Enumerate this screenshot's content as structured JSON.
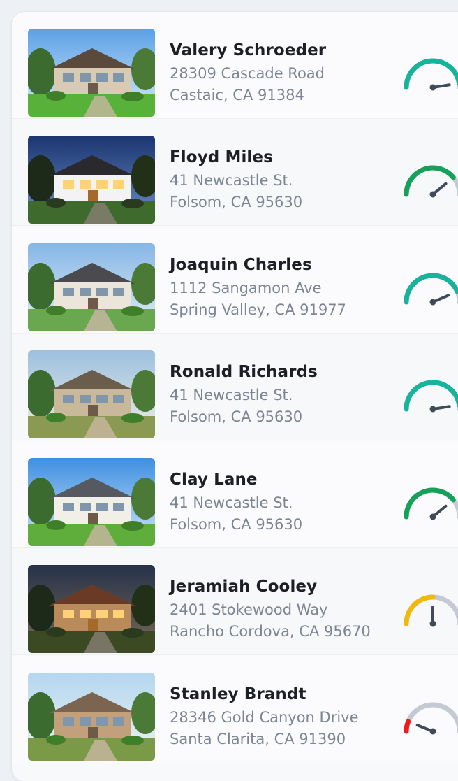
{
  "listings": [
    {
      "name": "Valery Schroeder",
      "address_line1": "28309 Cascade Road",
      "address_line2": "Castaic, CA 91384",
      "score_fraction": 0.95,
      "score_color": "#17b39a"
    },
    {
      "name": "Floyd Miles",
      "address_line1": "41 Newcastle St.",
      "address_line2": "Folsom, CA 95630",
      "score_fraction": 0.78,
      "score_color": "#16a15a"
    },
    {
      "name": "Joaquin Charles",
      "address_line1": "1112 Sangamon Ave",
      "address_line2": "Spring Valley, CA 91977",
      "score_fraction": 0.87,
      "score_color": "#17b39a"
    },
    {
      "name": "Ronald Richards",
      "address_line1": "41 Newcastle St.",
      "address_line2": "Folsom, CA 95630",
      "score_fraction": 0.95,
      "score_color": "#17b39a"
    },
    {
      "name": "Clay Lane",
      "address_line1": "41 Newcastle St.",
      "address_line2": "Folsom, CA 95630",
      "score_fraction": 0.78,
      "score_color": "#16a15a"
    },
    {
      "name": "Jeramiah Cooley",
      "address_line1": "2401 Stokewood Way",
      "address_line2": "Rancho Cordova, CA 95670",
      "score_fraction": 0.5,
      "score_color": "#f2b90c"
    },
    {
      "name": "Stanley Brandt",
      "address_line1": "28346 Gold Canyon Drive",
      "address_line2": "Santa Clarita, CA 91390",
      "score_fraction": 0.12,
      "score_color": "#ee1d1d"
    }
  ],
  "gauge_track_color": "#c3cad3",
  "needle_color": "#3f4a5a"
}
